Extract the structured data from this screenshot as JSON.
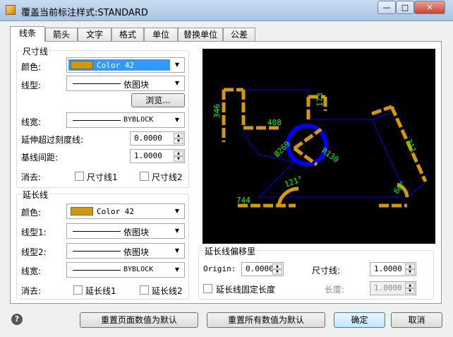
{
  "window": {
    "title": "覆盖当前标注样式:STANDARD",
    "minimize_glyph": "—",
    "maximize_glyph": "□",
    "close_glyph": "✕"
  },
  "tabs": [
    "线条",
    "箭头",
    "文字",
    "格式",
    "单位",
    "替换单位",
    "公差"
  ],
  "active_tab": "线条",
  "dim_lines": {
    "group_title": "尺寸线",
    "color_label": "颜色:",
    "color_value": "Color 42",
    "color_swatch": "#d09a00",
    "linetype_label": "线型:",
    "linetype_value": "依图块",
    "browse_button": "浏览...",
    "lineweight_label": "线宽:",
    "lineweight_value": "BYBLOCK",
    "extend_label": "延伸超过刻度线:",
    "extend_value": "0.0000",
    "baseline_label": "基线间距:",
    "baseline_value": "1.0000",
    "suppress_label": "消去:",
    "suppress_1": "尺寸线1",
    "suppress_2": "尺寸线2"
  },
  "ext_lines": {
    "group_title": "延长线",
    "color_label": "颜色:",
    "color_value": "Color 42",
    "linetype1_label": "线型1:",
    "linetype1_value": "依图块",
    "linetype2_label": "线型2:",
    "linetype2_value": "依图块",
    "lineweight_label": "线宽:",
    "lineweight_value": "BYBLOCK",
    "suppress_label": "消去:",
    "suppress_1": "延长线1",
    "suppress_2": "延长线2"
  },
  "ext_offset": {
    "group_title": "延长线偏移里",
    "origin_label": "Origin:",
    "origin_value": "0.0000",
    "dimline_label": "尺寸线:",
    "dimline_value": "1.0000",
    "fixed_label": "延长线固定长度",
    "length_label": "长度:",
    "length_value": "1.0000"
  },
  "preview": {
    "dim_346": "346",
    "dim_408": "408",
    "dim_173": "173",
    "dim_311": "311",
    "dim_r130": "R130",
    "dim_d269": "Ø269",
    "dim_744": "744",
    "dim_angle": "121°",
    "dim_60": "60°",
    "accent_color": "#d69a00",
    "dim_text_color": "#00ff00",
    "geometry_color": "#0000ff"
  },
  "footer": {
    "help_glyph": "?",
    "reset_page": "重置页面数值为默认",
    "reset_all": "重置所有数值为默认",
    "ok": "确定",
    "cancel": "取消"
  }
}
